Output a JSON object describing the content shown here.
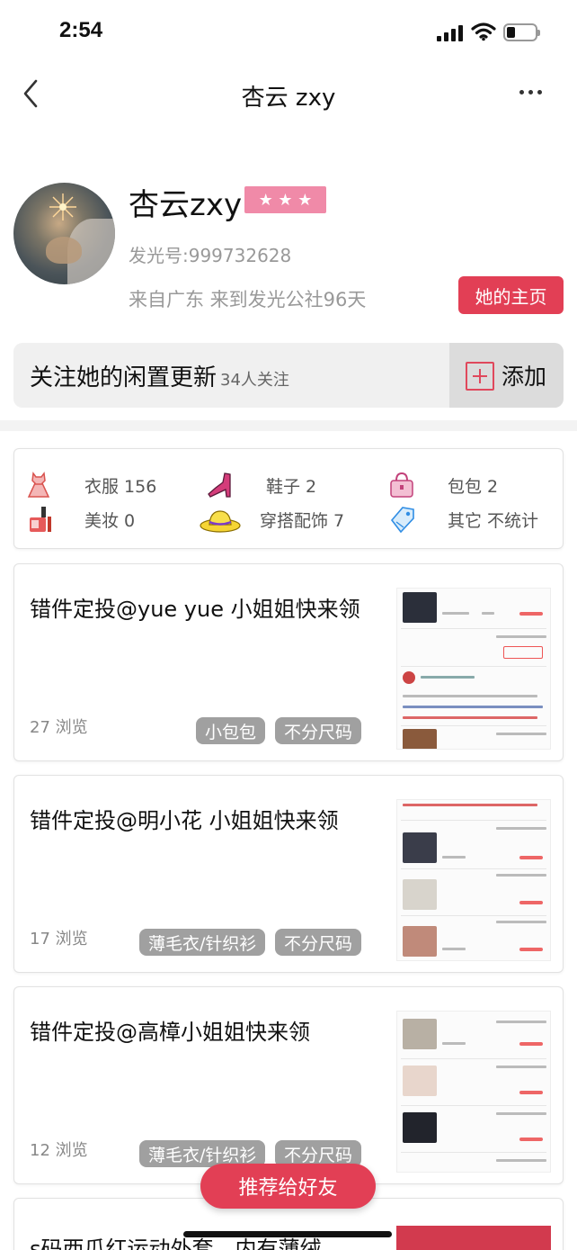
{
  "status_bar": {
    "time": "2:54",
    "battery_level": 0.3
  },
  "nav": {
    "title": "杏云 zxy"
  },
  "profile": {
    "username": "杏云zxy",
    "stars": "★ ★ ★",
    "star_count": 3,
    "faguang_id": "发光号:999732628",
    "from": "来自广东 来到发光公社96天",
    "home_button": "她的主页"
  },
  "follow": {
    "label": "关注她的闲置更新",
    "count": "34人关注",
    "add_label": "添加"
  },
  "categories": [
    {
      "icon": "dress-icon",
      "label": "衣服 156"
    },
    {
      "icon": "shoe-icon",
      "label": "鞋子 2"
    },
    {
      "icon": "handbag-icon",
      "label": "包包 2"
    },
    {
      "icon": "makeup-icon",
      "label": "美妆 0"
    },
    {
      "icon": "hat-icon",
      "label": "穿搭配饰 7"
    },
    {
      "icon": "tag-icon",
      "label": "其它 不统计"
    }
  ],
  "posts": [
    {
      "title": "错件定投@yue yue 小姐姐快来领",
      "views": "27 浏览",
      "tags": [
        "小包包",
        "不分尺码"
      ]
    },
    {
      "title": "错件定投@明小花 小姐姐快来领",
      "views": "17 浏览",
      "tags": [
        "薄毛衣/针织衫",
        "不分尺码"
      ]
    },
    {
      "title": "错件定投@高樟小姐姐快来领",
      "views": "12 浏览",
      "tags": [
        "薄毛衣/针织衫",
        "不分尺码"
      ]
    },
    {
      "title": "s码西瓜红运动外套，内有薄绒"
    }
  ],
  "recommend_button": "推荐给好友",
  "colors": {
    "accent": "#e23f55",
    "star_badge": "#f08aa8",
    "tag_bg": "#a0a0a0"
  }
}
